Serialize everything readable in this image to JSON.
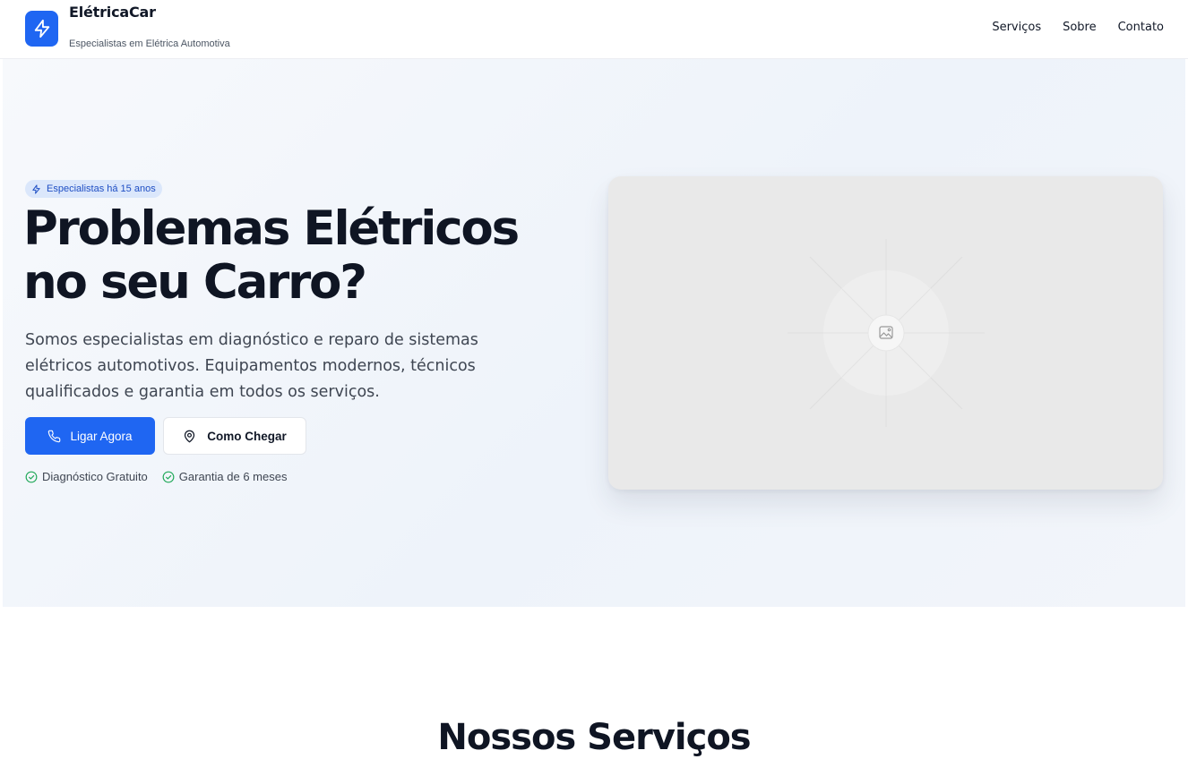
{
  "header": {
    "brand_name": "ElétricaCar",
    "brand_tagline": "Especialistas em Elétrica Automotiva",
    "nav": [
      "Serviços",
      "Sobre",
      "Contato"
    ],
    "logo_icon": "lightning-icon"
  },
  "hero": {
    "badge": "Especialistas há 15 anos",
    "title_line1": "Problemas Elétricos",
    "title_line2": "no seu Carro?",
    "description": "Somos especialistas em diagnóstico e reparo de sistemas elétricos automotivos. Equipamentos modernos, técnicos qualificados e garantia em todos os serviços.",
    "primary_button": "Ligar Agora",
    "secondary_button": "Como Chegar",
    "features": [
      "Diagnóstico Gratuito",
      "Garantia de 6 meses"
    ]
  },
  "services": {
    "title": "Nossos Serviços"
  },
  "colors": {
    "accent": "#1f66f2",
    "badge_bg": "#dbe7fb",
    "success": "#22a95a"
  }
}
